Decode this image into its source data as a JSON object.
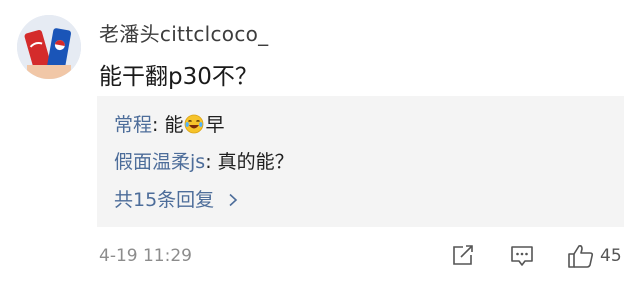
{
  "comment": {
    "username": "老潘头cittclcoco_",
    "text": "能干翻p30不？",
    "timestamp": "4-19 11:29",
    "like_count": "45"
  },
  "replies": [
    {
      "author": "常程",
      "separator": ": ",
      "text_before": "能",
      "emoji": "laughing-crying-emoji",
      "text_after": "早"
    },
    {
      "author": "假面温柔js",
      "separator": ": ",
      "text": "真的能？"
    }
  ],
  "more_replies_label": "共15条回复",
  "icons": {
    "share": "share-icon",
    "reply": "comment-icon",
    "like": "thumbs-up-icon",
    "more_chevron": "chevron-right-icon"
  },
  "colors": {
    "link_blue": "#4d6d9a",
    "reply_bg": "#f4f4f4",
    "meta_gray": "#8c8c8c"
  }
}
